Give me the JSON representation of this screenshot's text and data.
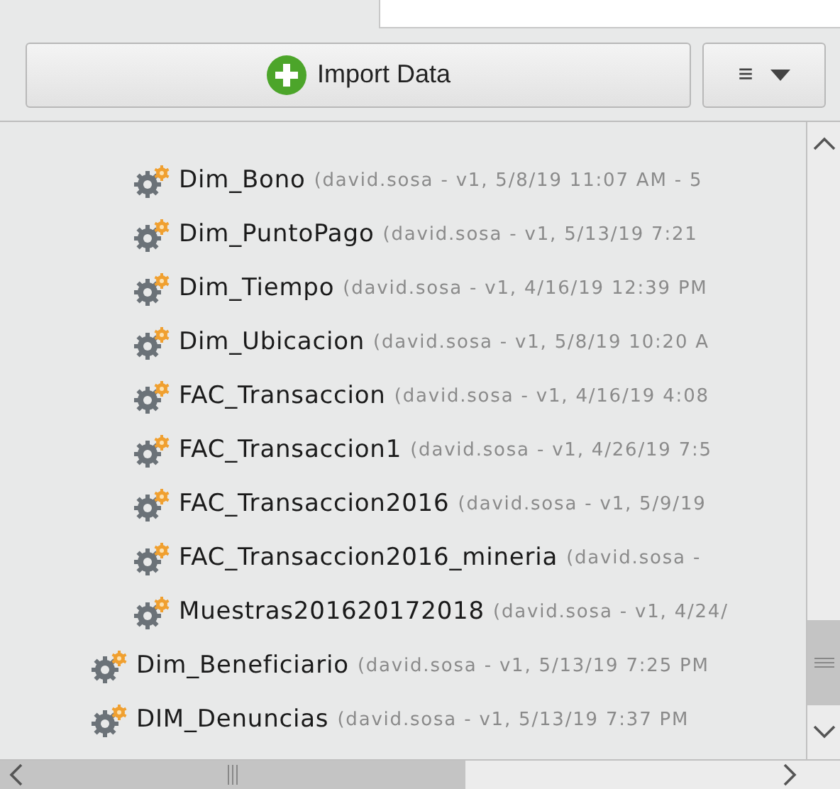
{
  "toolbar": {
    "import_button": "Import Data",
    "menu_button": {
      "icon": "≡"
    }
  },
  "tree": {
    "items": [
      {
        "children": [
          {
            "name": "Dim_Bono",
            "meta": "(david.sosa - v1, 5/8/19 11:07 AM - 5"
          },
          {
            "name": "Dim_PuntoPago",
            "meta": "(david.sosa - v1, 5/13/19 7:21"
          },
          {
            "name": "Dim_Tiempo",
            "meta": "(david.sosa - v1, 4/16/19 12:39 PM"
          },
          {
            "name": "Dim_Ubicacion",
            "meta": "(david.sosa - v1, 5/8/19 10:20 A"
          },
          {
            "name": "FAC_Transaccion",
            "meta": "(david.sosa - v1, 4/16/19 4:08"
          },
          {
            "name": "FAC_Transaccion1",
            "meta": "(david.sosa - v1, 4/26/19 7:5"
          },
          {
            "name": "FAC_Transaccion2016",
            "meta": "(david.sosa - v1, 5/9/19"
          },
          {
            "name": "FAC_Transaccion2016_mineria",
            "meta": "(david.sosa -"
          },
          {
            "name": "Muestras201620172018",
            "meta": "(david.sosa - v1, 4/24/"
          }
        ]
      },
      {
        "name": "Dim_Beneficiario",
        "meta": "(david.sosa - v1, 5/13/19 7:25 PM"
      },
      {
        "name": "DIM_Denuncias",
        "meta": "(david.sosa - v1, 5/13/19 7:37 PM"
      }
    ]
  }
}
